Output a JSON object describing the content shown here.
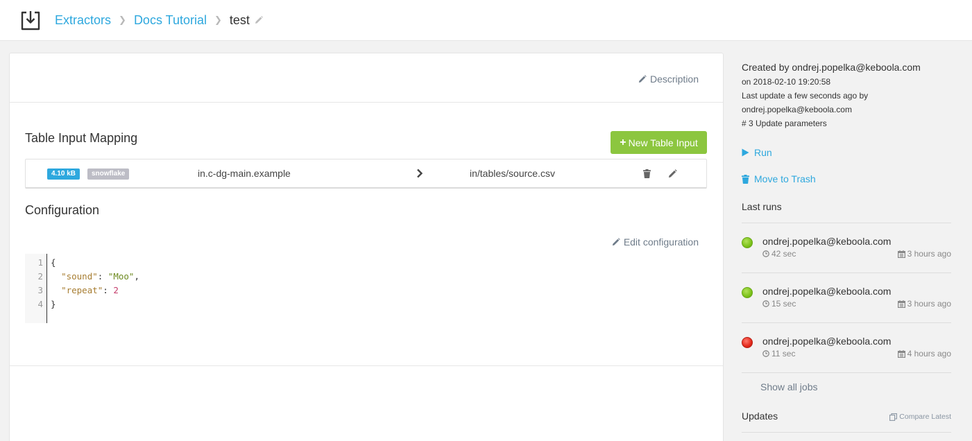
{
  "breadcrumb": {
    "items": [
      "Extractors",
      "Docs Tutorial"
    ],
    "current": "test"
  },
  "description": {
    "label": "Description"
  },
  "table_input_mapping": {
    "title": "Table Input Mapping",
    "new_button": "New Table Input",
    "rows": [
      {
        "size": "4.10 kB",
        "backend": "snowflake",
        "source": "in.c-dg-main.example",
        "destination": "in/tables/source.csv"
      }
    ]
  },
  "configuration": {
    "title": "Configuration",
    "edit_label": "Edit configuration",
    "line_numbers": [
      "1",
      "2",
      "3",
      "4"
    ],
    "code": {
      "open": "{",
      "key1": "\"sound\"",
      "val1": "\"Moo\"",
      "key2": "\"repeat\"",
      "val2": "2",
      "close": "}"
    }
  },
  "sidebar": {
    "created_by": "Created by ondrej.popelka@keboola.com",
    "created_on": "on 2018-02-10 19:20:58",
    "last_update": "Last update a few seconds ago by",
    "last_update_user": "ondrej.popelka@keboola.com",
    "version_note": "# 3 Update parameters",
    "run_label": "Run",
    "trash_label": "Move to Trash",
    "last_runs_title": "Last runs",
    "runs": [
      {
        "user": "ondrej.popelka@keboola.com",
        "duration": "42 sec",
        "ago": "3 hours ago",
        "status": "success"
      },
      {
        "user": "ondrej.popelka@keboola.com",
        "duration": "15 sec",
        "ago": "3 hours ago",
        "status": "success"
      },
      {
        "user": "ondrej.popelka@keboola.com",
        "duration": "11 sec",
        "ago": "4 hours ago",
        "status": "error"
      }
    ],
    "show_all": "Show all jobs",
    "updates_title": "Updates",
    "compare_latest": "Compare Latest"
  },
  "colors": {
    "accent": "#2ea8de",
    "success_button": "#8cc63f",
    "status_success": "#7cc21a",
    "status_error": "#e3281b"
  }
}
